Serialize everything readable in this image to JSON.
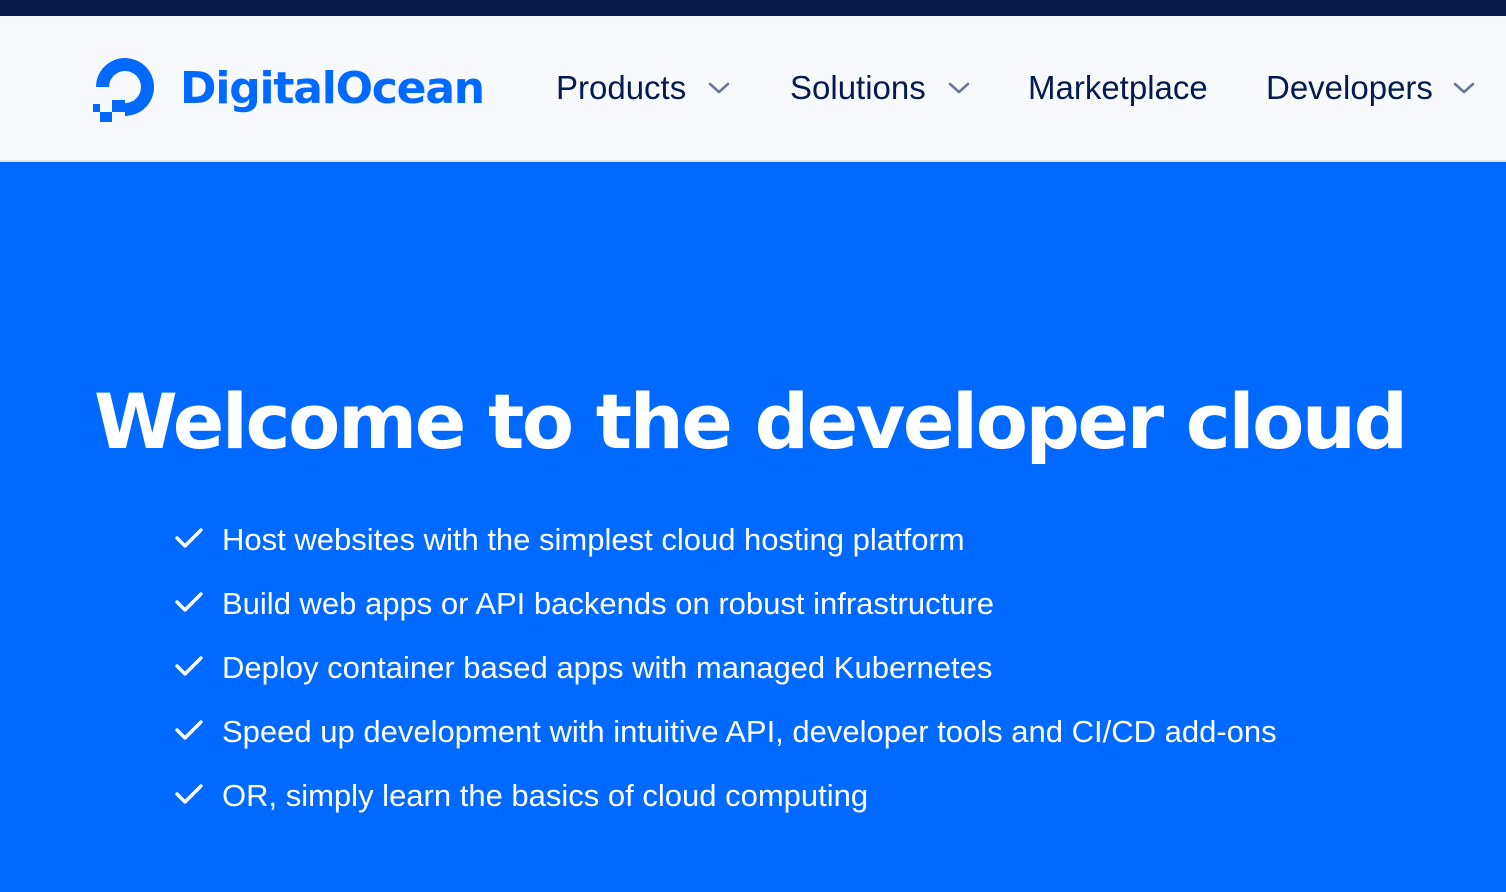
{
  "brand": {
    "name": "DigitalOcean",
    "color": "#0069ff",
    "logo_icon": "digitalocean-logo-icon"
  },
  "colors": {
    "top_bar": "#061a47",
    "header_bg": "#f7f9fd",
    "nav_text": "#031b4e",
    "hero_bg": "#0069ff",
    "hero_text": "#ffffff"
  },
  "nav": {
    "items": [
      {
        "label": "Products",
        "has_dropdown": true,
        "icon": "chevron-down-icon"
      },
      {
        "label": "Solutions",
        "has_dropdown": true,
        "icon": "chevron-down-icon"
      },
      {
        "label": "Marketplace",
        "has_dropdown": false
      },
      {
        "label": "Developers",
        "has_dropdown": true,
        "icon": "chevron-down-icon"
      }
    ]
  },
  "hero": {
    "title": "Welcome to the developer cloud",
    "features": [
      "Host websites with the simplest cloud hosting platform",
      "Build web apps or API backends on robust infrastructure",
      "Deploy container based apps with managed Kubernetes",
      "Speed up development with intuitive API, developer tools and CI/CD add-ons",
      "OR, simply learn the basics of cloud computing"
    ],
    "feature_icon": "check-icon"
  }
}
